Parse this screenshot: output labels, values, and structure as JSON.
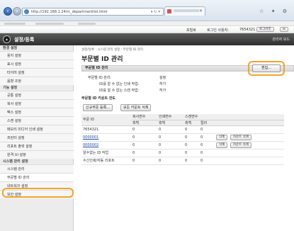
{
  "browser": {
    "url": "http://192.168.1.24/rc_departmentlist.html",
    "url_controls": "▾ ↻ ✕",
    "window_controls": "☆ ✦ ⚙"
  },
  "header": {
    "portal": "포털로",
    "login_user_label": "로그인 사용자:",
    "login_user_value": "7654321",
    "logout_button": "로그아웃",
    "mail_button": "✉"
  },
  "titlebar": {
    "app_title": "설정/등록",
    "admin_mode": "관리자 모드"
  },
  "sidebar": {
    "sections": [
      {
        "label": "환경 설정"
      },
      {
        "label": "기능 설정"
      },
      {
        "label": "시스템 관리 설정"
      }
    ],
    "items": [
      {
        "label": "용지 설정"
      },
      {
        "label": "표시 설정"
      },
      {
        "label": "타이머 설정"
      },
      {
        "label": "음향 조정"
      },
      {
        "label": "공통 설정"
      },
      {
        "label": "복사 설정"
      },
      {
        "label": "팩스 설정"
      },
      {
        "label": "스캔 설정"
      },
      {
        "label": "메모리 미디어 인쇄 설정"
      },
      {
        "label": "프린터 설정"
      },
      {
        "label": "리포트 출력 설정"
      },
      {
        "label": "원격 UI 설정"
      },
      {
        "label": "시스템 관리"
      },
      {
        "label": "부문별 ID 관리"
      },
      {
        "label": "네트워크 설정"
      },
      {
        "label": "보안 설정"
      }
    ]
  },
  "main": {
    "breadcrumb": "설정/등록 : 시스템 관리 설정 : 부문별 ID 관리",
    "page_title": "부문별 ID 관리",
    "section_title": "부문별 ID 관리",
    "edit_button": "편집...",
    "props": [
      {
        "label": "부문별 ID 관리:",
        "value": "설정"
      },
      {
        "label": "ID를 알 수 없는 인쇄 작업:",
        "value": "허가"
      },
      {
        "label": "ID를 알 수 없는 스캔 작업:",
        "value": "허가"
      }
    ],
    "counter_section_title": "부문별 ID 카운트 한도",
    "register_button": "신규부문 등록...",
    "clear_all_button": "모든 카운트 삭제",
    "table": {
      "id_header": "부문 ID",
      "group_headers": [
        "복사면수",
        "인쇄면수",
        "스캔면수"
      ],
      "sub_headers": [
        "흑백",
        "흑백",
        "흑백",
        "컬러"
      ],
      "rows": [
        {
          "id": "7654321",
          "values": [
            "0",
            "0",
            "0",
            "0"
          ],
          "is_link": false,
          "actions": []
        },
        {
          "id": "0000001",
          "values": [
            "0",
            "0",
            "0",
            "0"
          ],
          "is_link": true,
          "actions": [
            "삭제",
            "카운트 삭제"
          ]
        },
        {
          "id": "0000002",
          "values": [
            "0",
            "0",
            "0",
            "0"
          ],
          "is_link": true,
          "actions": [
            "삭제",
            "카운트 삭제"
          ]
        },
        {
          "id": "알수없는 ID 작업",
          "values": [
            "0",
            "0",
            "0",
            "0"
          ],
          "is_link": false,
          "actions": []
        },
        {
          "id": "수신인쇄/자동 리포트",
          "values": [
            "0",
            "0",
            "0",
            "0"
          ],
          "is_link": false,
          "actions": []
        }
      ]
    }
  }
}
